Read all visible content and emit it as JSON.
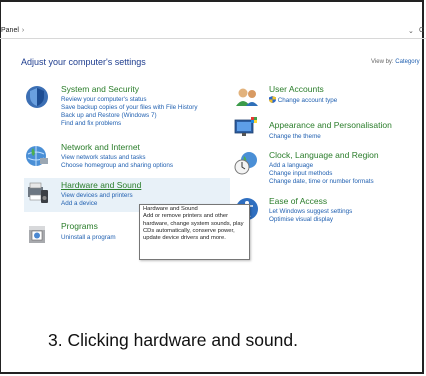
{
  "address_bar": {
    "path": "Panel",
    "separator": "›",
    "dropdown": "⌄",
    "refresh": "C"
  },
  "heading": "Adjust your computer's settings",
  "view_by": {
    "label": "View by:",
    "value": "Category"
  },
  "categories_left": [
    {
      "title": "System and Security",
      "icon": "shield-icon",
      "links": [
        "Review your computer's status",
        "Save backup copies of your files with File History",
        "Back up and Restore (Windows 7)",
        "Find and fix problems"
      ]
    },
    {
      "title": "Network and Internet",
      "icon": "network-globe-icon",
      "links": [
        "View network status and tasks",
        "Choose homegroup and sharing options"
      ]
    },
    {
      "title": "Hardware and Sound",
      "icon": "printer-speaker-icon",
      "links": [
        "View devices and printers",
        "Add a device"
      ]
    },
    {
      "title": "Programs",
      "icon": "programs-box-icon",
      "links": [
        "Uninstall a program"
      ]
    }
  ],
  "categories_right": [
    {
      "title": "User Accounts",
      "icon": "user-accounts-icon",
      "links": [
        "Change account type"
      ]
    },
    {
      "title": "Appearance and Personalisation",
      "icon": "monitor-palette-icon",
      "links": [
        "Change the theme"
      ]
    },
    {
      "title": "Clock, Language and Region",
      "icon": "clock-globe-icon",
      "links": [
        "Add a language",
        "Change input methods",
        "Change date, time or number formats"
      ]
    },
    {
      "title": "Ease of Access",
      "icon": "ease-of-access-icon",
      "links": [
        "Let Windows suggest settings",
        "Optimise visual display"
      ]
    }
  ],
  "tooltip": {
    "title": "Hardware and Sound",
    "body": "Add or remove printers and other hardware, change system sounds, play CDs automatically, conserve power, update device drivers and more."
  },
  "caption": "3. Clicking hardware and sound.",
  "colors": {
    "category_title": "#2a7d2a",
    "link": "#1f5fb0",
    "heading": "#1e3d8f",
    "hover": "#e8f1f8"
  }
}
